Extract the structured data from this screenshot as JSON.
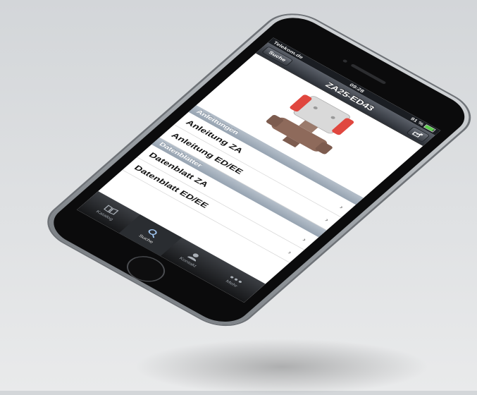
{
  "status_bar": {
    "carrier": "Telekom.de",
    "time": "09:28",
    "battery_percent": "91 %",
    "battery_level": 0.91
  },
  "nav": {
    "back_label": "Suche",
    "title": "ZA25-ED43",
    "share_icon": "share-icon"
  },
  "product_image": {
    "description_icon": "valve-actuator"
  },
  "sections": [
    {
      "header": "Anleitungen",
      "items": [
        "Anleitung ZA",
        "Anleitung ED/EE"
      ]
    },
    {
      "header": "Datenblätter",
      "items": [
        "Datenblatt ZA",
        "Datenblatt ED/EE"
      ]
    }
  ],
  "tabbar": {
    "tabs": [
      {
        "label": "Katalog",
        "icon": "book-icon"
      },
      {
        "label": "Suche",
        "icon": "search-icon",
        "active": true
      },
      {
        "label": "Kontakt",
        "icon": "person-icon"
      },
      {
        "label": "Mehr",
        "icon": "more-icon"
      }
    ]
  },
  "colors": {
    "actuator_red": "#e0473f",
    "valve_brown": "#8e6a5b",
    "section_bg": "#a4b0bd"
  }
}
